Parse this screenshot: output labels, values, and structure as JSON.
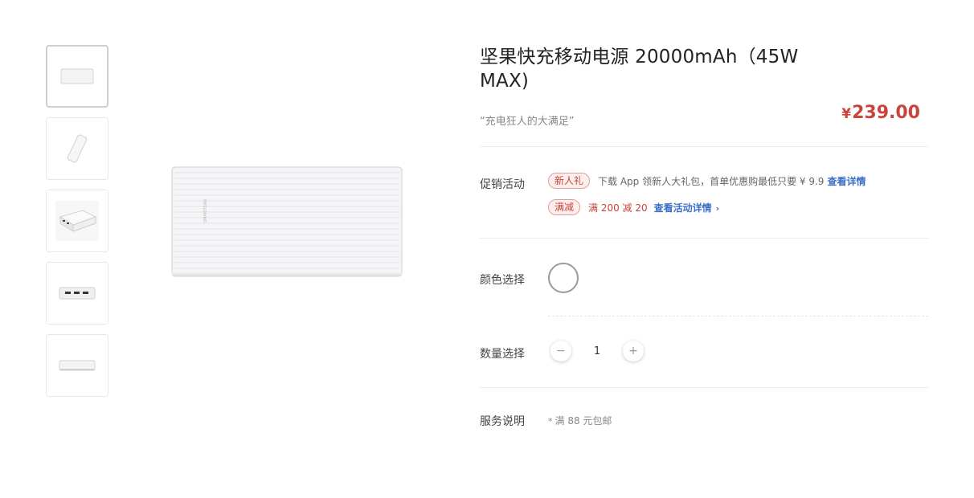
{
  "thumbnails": [
    {
      "name": "thumb-front"
    },
    {
      "name": "thumb-angle"
    },
    {
      "name": "thumb-ports-perspective"
    },
    {
      "name": "thumb-ports"
    },
    {
      "name": "thumb-side"
    }
  ],
  "product": {
    "title": "坚果快充移动电源 20000mAh（45W MAX)",
    "subtitle": "“充电狂人的大满足”",
    "price_currency": "¥",
    "price_value": "239.00"
  },
  "promotion": {
    "label": "促销活动",
    "items": [
      {
        "tag": "新人礼",
        "text": "下载 App 领新人大礼包，首单优惠购最低只要 ¥ 9.9",
        "link": "查看详情"
      },
      {
        "tag": "满减",
        "text": "满 200 减 20",
        "link": "查看活动详情",
        "chevron": "›"
      }
    ]
  },
  "color": {
    "label": "颜色选择"
  },
  "quantity": {
    "label": "数量选择",
    "minus": "−",
    "value": "1",
    "plus": "+"
  },
  "service": {
    "label": "服务说明",
    "star": "*",
    "text": "满 88 元包邮"
  },
  "colors": {
    "price": "#c9443b",
    "link": "#3b6fc7",
    "tag_border": "#e79a9a",
    "tag_bg": "#fdeeee"
  }
}
